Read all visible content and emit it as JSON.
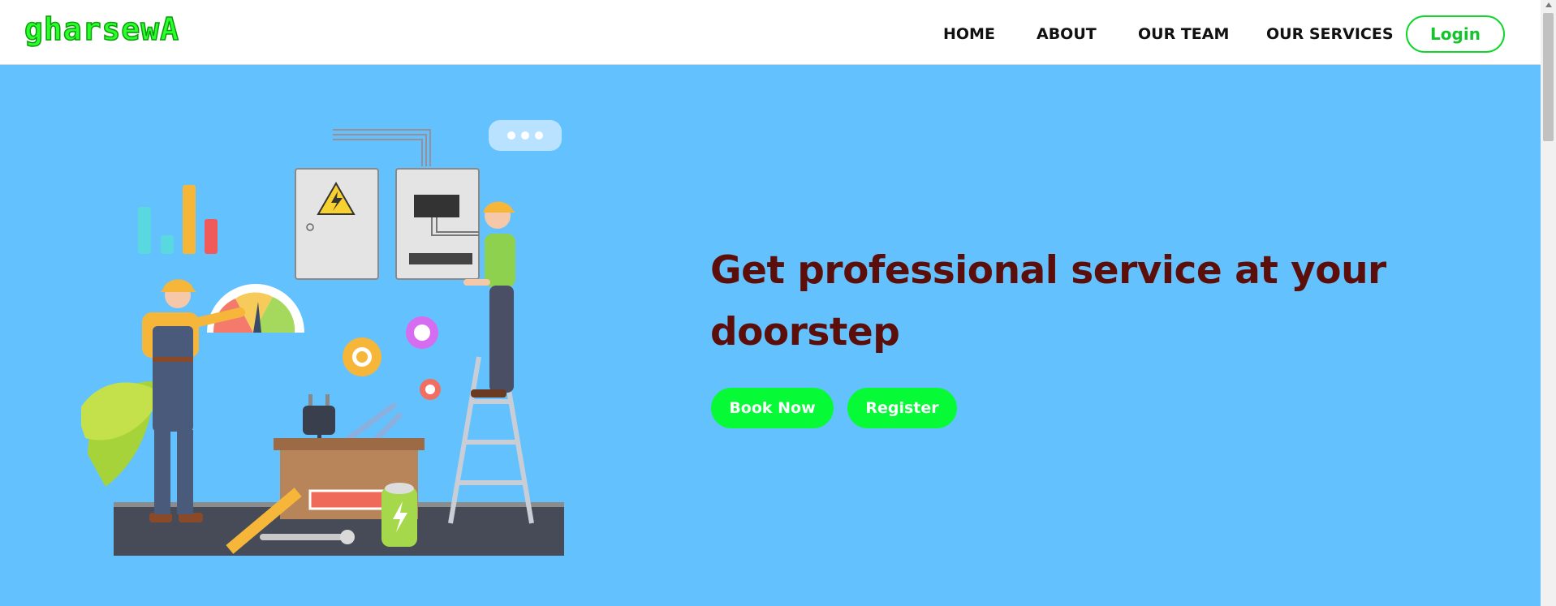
{
  "brand": {
    "logo_text": "gharsewA",
    "logo_color": "#2bff2b"
  },
  "nav": {
    "items": [
      {
        "label": "HOME"
      },
      {
        "label": "ABOUT"
      },
      {
        "label": "OUR TEAM"
      },
      {
        "label": "OUR SERVICES"
      }
    ],
    "login_label": "Login"
  },
  "hero": {
    "headline": "Get professional service at your doorstep",
    "buttons": {
      "book_label": "Book Now",
      "register_label": "Register"
    },
    "illustration": "electricians-at-work-illustration"
  },
  "colors": {
    "hero_background": "#63c2fd",
    "headline": "#5c0f0a",
    "cta_button": "#06fa36",
    "login_border": "#0fd62b"
  }
}
